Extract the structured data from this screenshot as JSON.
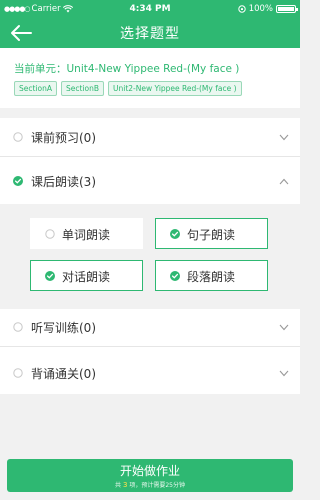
{
  "status_bar": {
    "carrier": "Carrier",
    "time": "4:34 PM",
    "battery": "100%"
  },
  "nav": {
    "title": "选择题型",
    "back_icon": "back-arrow-icon"
  },
  "unit": {
    "title": "当前单元：Unit4-New Yippee Red-(My face )",
    "tags": [
      "SectionA",
      "SectionB",
      "Unit2-New Yippee Red-(My face )"
    ]
  },
  "sections": [
    {
      "label": "课前预习(0)",
      "checked": false,
      "expanded": false
    },
    {
      "label": "课后朗读(3)",
      "checked": true,
      "expanded": true
    },
    {
      "label": "听写训练(0)",
      "checked": false,
      "expanded": false
    },
    {
      "label": "背诵通关(0)",
      "checked": false,
      "expanded": false
    }
  ],
  "reading_options": [
    {
      "label": "单词朗读",
      "selected": false
    },
    {
      "label": "句子朗读",
      "selected": true
    },
    {
      "label": "对话朗读",
      "selected": true
    },
    {
      "label": "段落朗读",
      "selected": true
    }
  ],
  "bottom": {
    "button_label": "开始做作业",
    "info_prefix": "共",
    "count": "3",
    "info_suffix": "项，预计需要25分钟"
  },
  "colors": {
    "accent": "#2eb872",
    "background": "#f1f1f1"
  }
}
